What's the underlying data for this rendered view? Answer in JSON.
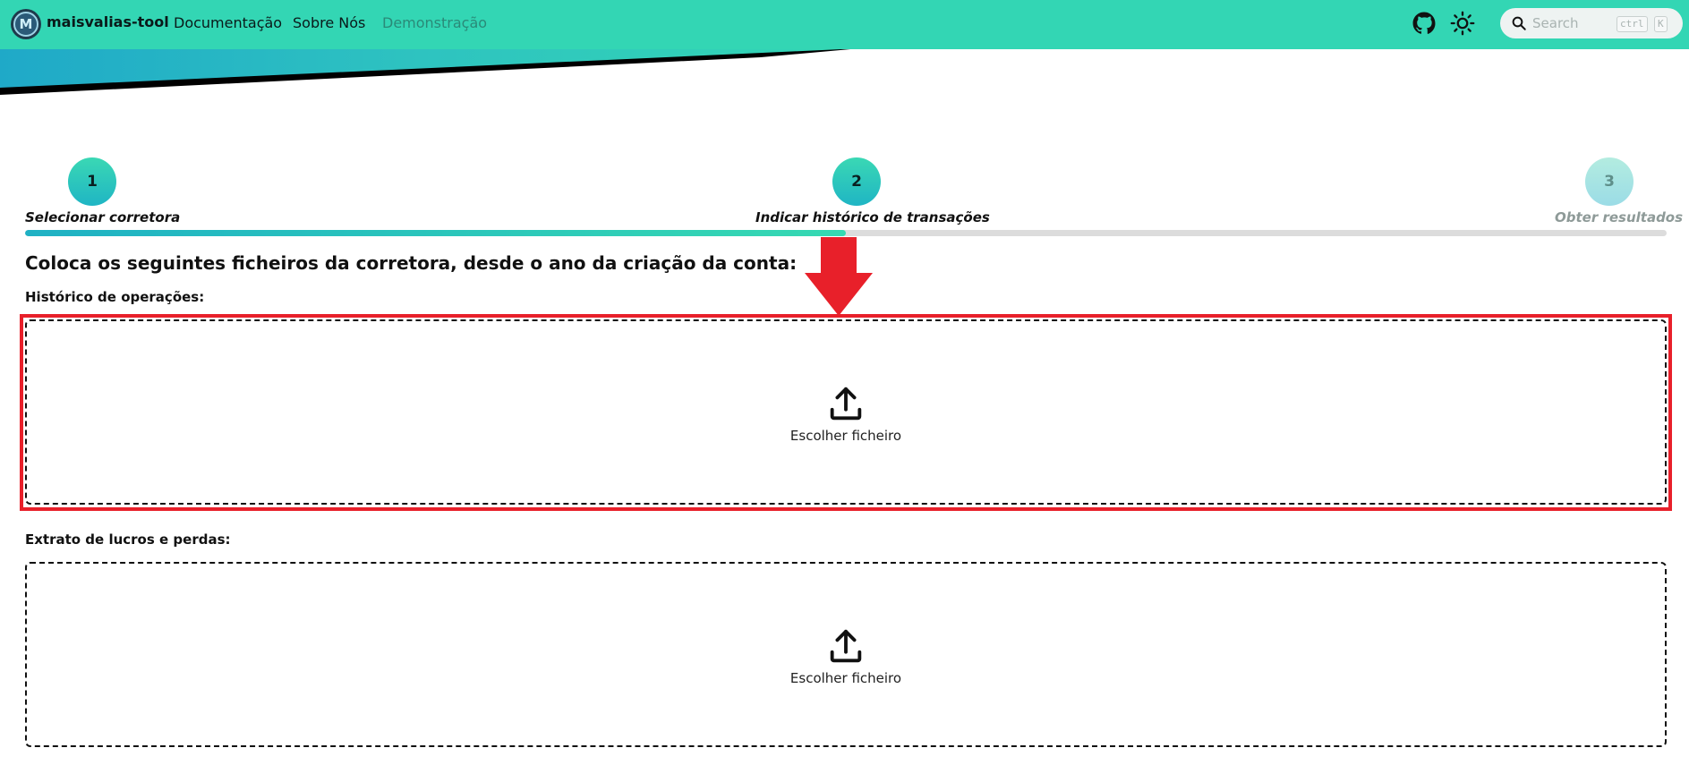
{
  "nav": {
    "brand": "maisvalias-tool",
    "logo_letter": "M",
    "links": [
      "Documentação",
      "Sobre Nós",
      "Demonstração"
    ],
    "search_placeholder": "Search",
    "kbd_ctrl": "ctrl",
    "kbd_k": "K"
  },
  "stepper": {
    "steps": [
      {
        "number": "1",
        "label": "Selecionar corretora",
        "state": "done"
      },
      {
        "number": "2",
        "label": "Indicar histórico de transações",
        "state": "active"
      },
      {
        "number": "3",
        "label": "Obter resultados",
        "state": "pending"
      }
    ],
    "progress_fraction": 0.5
  },
  "main": {
    "heading": "Coloca os seguintes ficheiros da corretora, desde o ano da criação da conta:",
    "sections": [
      {
        "label": "Histórico de operações:",
        "button": "Escolher ficheiro"
      },
      {
        "label": "Extrato de lucros e perdas:",
        "button": "Escolher ficheiro"
      }
    ]
  },
  "colors": {
    "nav_bg": "#33d6b4",
    "accent_teal": "#1fb5c4",
    "annotation_red": "#e8202a"
  },
  "icons": [
    "github-icon",
    "sun-icon",
    "search-icon",
    "upload-icon",
    "arrow-down-icon"
  ]
}
